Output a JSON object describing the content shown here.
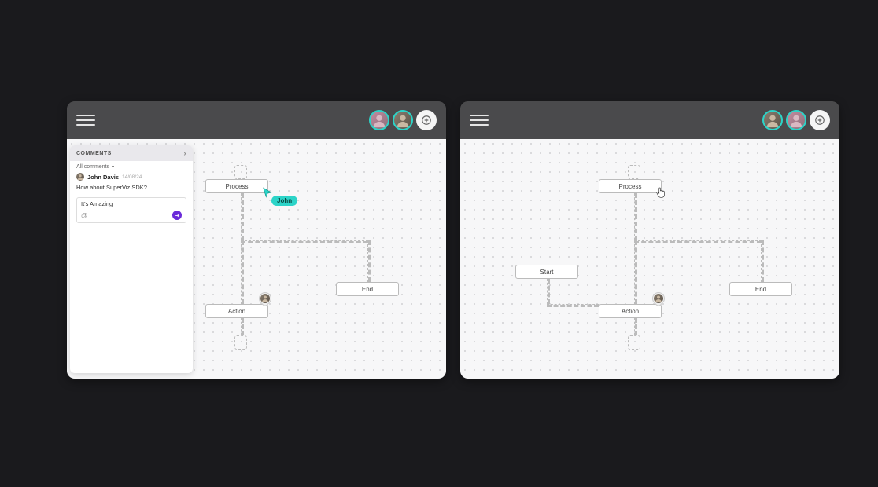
{
  "colors": {
    "accent_teal": "#2cd4c8",
    "accent_purple": "#6b2bd9",
    "bg_dark": "#1a1a1d",
    "bg_header": "#4a4a4c"
  },
  "left": {
    "comments": {
      "title": "COMMENTS",
      "filter_label": "All comments",
      "author": "John Davis",
      "date": "14/08/24",
      "text": "How about SuperViz SDK?",
      "reply_value": "It's Amazing",
      "mention_symbol": "@"
    },
    "cursor_user": "John",
    "nodes": {
      "process": "Process",
      "action": "Action",
      "end": "End"
    }
  },
  "right": {
    "nodes": {
      "process": "Process",
      "start": "Start",
      "action": "Action",
      "end": "End"
    }
  }
}
